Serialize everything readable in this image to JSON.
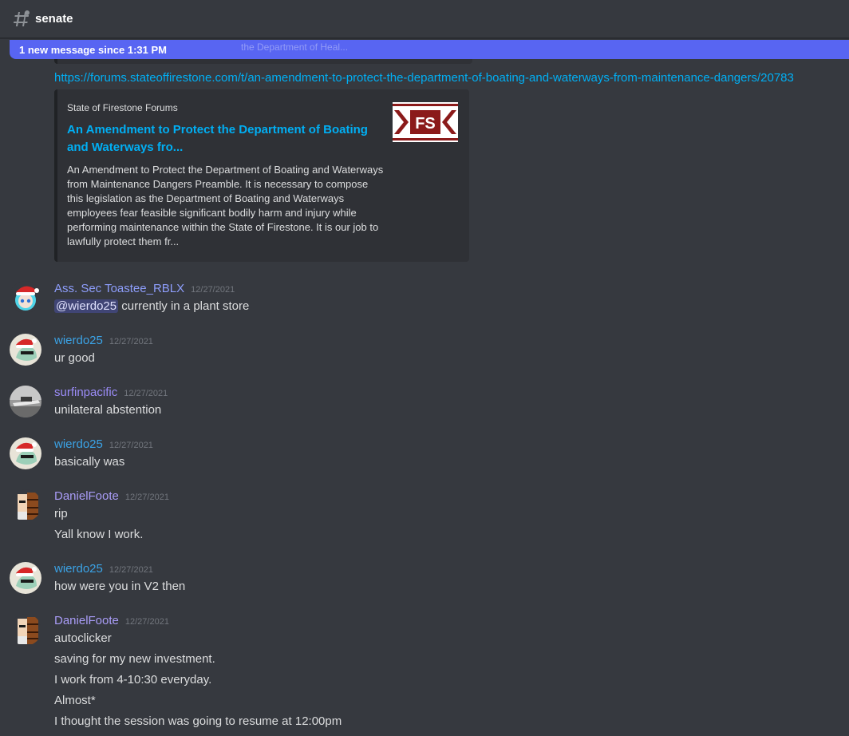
{
  "channel": {
    "icon": "hashtag-icon",
    "name": "senate"
  },
  "new_messages_bar": {
    "label": "1 new message since 1:31 PM",
    "ghost_text": "the Department of Heal..."
  },
  "link_message": {
    "url": "https://forums.stateoffirestone.com/t/an-amendment-to-protect-the-department-of-boating-and-waterways-from-maintenance-dangers/20783",
    "embed": {
      "provider": "State of Firestone Forums",
      "title": "An Amendment to Protect the Department of Boating and Waterways fro...",
      "description": "An Amendment to Protect the Department of Boating and Waterways from Maintenance Dangers Preamble. It is necessary to compose this legislation as the Department of Boating and Waterways employees fear feasible significant bodily harm and injury while performing maintenance within the State of Firestone. It is our job to lawfully protect them fr...",
      "thumbnail_text": "FS"
    }
  },
  "messages": [
    {
      "author": "Ass. Sec Toastee_RBLX",
      "author_color": "#8e9efc",
      "timestamp": "12/27/2021",
      "mention": "@wierdo25",
      "lines": [
        "currently in a plant store"
      ]
    },
    {
      "author": "wierdo25",
      "author_color": "#3ba3e6",
      "timestamp": "12/27/2021",
      "lines": [
        "ur good"
      ]
    },
    {
      "author": "surfinpacific",
      "author_color": "#9b8cf7",
      "timestamp": "12/27/2021",
      "lines": [
        "unilateral abstention"
      ]
    },
    {
      "author": "wierdo25",
      "author_color": "#3ba3e6",
      "timestamp": "12/27/2021",
      "lines": [
        "basically was"
      ]
    },
    {
      "author": "DanielFoote",
      "author_color": "#a99cf7",
      "timestamp": "12/27/2021",
      "lines": [
        "rip",
        "Yall know I work."
      ]
    },
    {
      "author": "wierdo25",
      "author_color": "#3ba3e6",
      "timestamp": "12/27/2021",
      "lines": [
        "how were you in V2 then"
      ]
    },
    {
      "author": "DanielFoote",
      "author_color": "#a99cf7",
      "timestamp": "12/27/2021",
      "lines": [
        "autoclicker",
        "saving for my new investment.",
        "I work from 4-10:30 everyday.",
        "Almost*",
        "I thought the session was going to resume at 12:00pm"
      ]
    }
  ]
}
